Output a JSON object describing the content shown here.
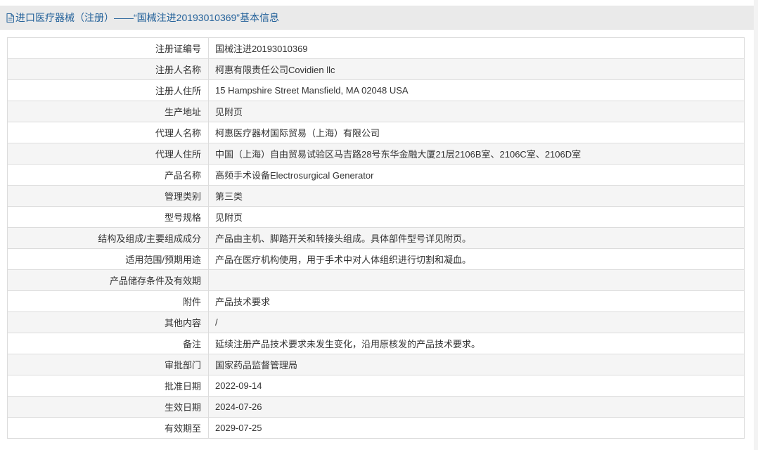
{
  "header": {
    "title": "进口医疗器械（注册）——“国械注进20193010369”基本信息",
    "icon": "document-icon",
    "color": "#23619a"
  },
  "rows": [
    {
      "label": "注册证编号",
      "value": "国械注进20193010369"
    },
    {
      "label": "注册人名称",
      "value": "柯惠有限责任公司Covidien llc"
    },
    {
      "label": "注册人住所",
      "value": "15 Hampshire Street Mansfield, MA 02048 USA"
    },
    {
      "label": "生产地址",
      "value": "见附页"
    },
    {
      "label": "代理人名称",
      "value": "柯惠医疗器材国际贸易（上海）有限公司"
    },
    {
      "label": "代理人住所",
      "value": "中国（上海）自由贸易试验区马吉路28号东华金融大厦21层2106B室、2106C室、2106D室"
    },
    {
      "label": "产品名称",
      "value": "高频手术设备Electrosurgical Generator"
    },
    {
      "label": "管理类别",
      "value": "第三类"
    },
    {
      "label": "型号规格",
      "value": "见附页"
    },
    {
      "label": "结构及组成/主要组成成分",
      "value": "产品由主机、脚踏开关和转接头组成。具体部件型号详见附页。"
    },
    {
      "label": "适用范围/预期用途",
      "value": "产品在医疗机构使用，用于手术中对人体组织进行切割和凝血。"
    },
    {
      "label": "产品储存条件及有效期",
      "value": ""
    },
    {
      "label": "附件",
      "value": "产品技术要求"
    },
    {
      "label": "其他内容",
      "value": "/"
    },
    {
      "label": "备注",
      "value": "延续注册产品技术要求未发生变化，沿用原核发的产品技术要求。"
    },
    {
      "label": "审批部门",
      "value": "国家药品监督管理局"
    },
    {
      "label": "批准日期",
      "value": "2022-09-14"
    },
    {
      "label": "生效日期",
      "value": "2024-07-26"
    },
    {
      "label": "有效期至",
      "value": "2029-07-25"
    }
  ]
}
